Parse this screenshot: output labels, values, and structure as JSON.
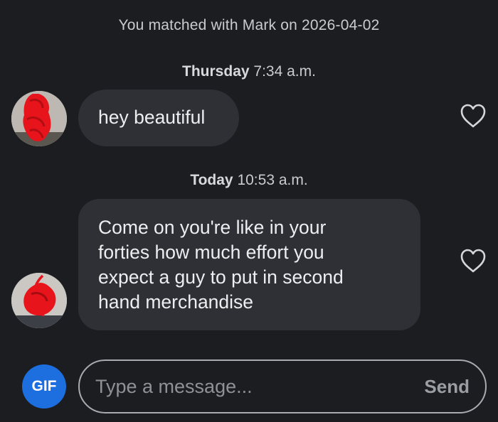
{
  "conversation": {
    "match_note": "You matched with Mark on 2026-04-02",
    "messages": [
      {
        "day": "Thursday",
        "time": "7:34 a.m.",
        "text": "hey beautiful",
        "liked": false
      },
      {
        "day": "Today",
        "time": "10:53 a.m.",
        "text": "Come on you're like in your\nforties how much effort you\nexpect a guy to put in second\nhand  merchandise",
        "liked": false
      }
    ]
  },
  "composer": {
    "gif_label": "GIF",
    "placeholder": "Type a message...",
    "value": "",
    "send_label": "Send"
  },
  "icons": {
    "like": "heart-outline-icon",
    "gif": "gif-icon"
  },
  "colors": {
    "background": "#1b1d21",
    "bubble": "#2e3035",
    "gif_button": "#1d6fe0",
    "redaction": "#e8141b"
  }
}
